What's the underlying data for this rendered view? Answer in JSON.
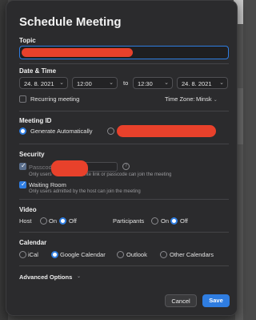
{
  "dialog": {
    "title": "Schedule Meeting"
  },
  "topic": {
    "label": "Topic"
  },
  "datetime": {
    "label": "Date & Time",
    "start_date": "24. 8. 2021",
    "start_time": "12:00",
    "to": "to",
    "end_time": "12:30",
    "end_date": "24. 8. 2021",
    "recurring_label": "Recurring meeting",
    "timezone_label": "Time Zone:",
    "timezone_value": "Minsk"
  },
  "meeting_id": {
    "label": "Meeting ID",
    "generate_label": "Generate Automatically"
  },
  "security": {
    "label": "Security",
    "passcode_label": "Passcode",
    "passcode_note_part": "invite link or passcode can join the meeting",
    "passcode_note_prefix": "Only users",
    "waiting_room_label": "Waiting Room",
    "waiting_room_note": "Only users admitted by the host can join the meeting"
  },
  "video": {
    "label": "Video",
    "host_label": "Host",
    "participants_label": "Participants",
    "on": "On",
    "off": "Off"
  },
  "calendar": {
    "label": "Calendar",
    "options": [
      "iCal",
      "Google Calendar",
      "Outlook",
      "Other Calendars"
    ],
    "selected": "Google Calendar"
  },
  "advanced": {
    "label": "Advanced Options"
  },
  "buttons": {
    "cancel": "Cancel",
    "save": "Save"
  },
  "colors": {
    "accent": "#2f7de1",
    "redaction": "#e8412b",
    "dialog_bg": "#2b2b2d"
  }
}
